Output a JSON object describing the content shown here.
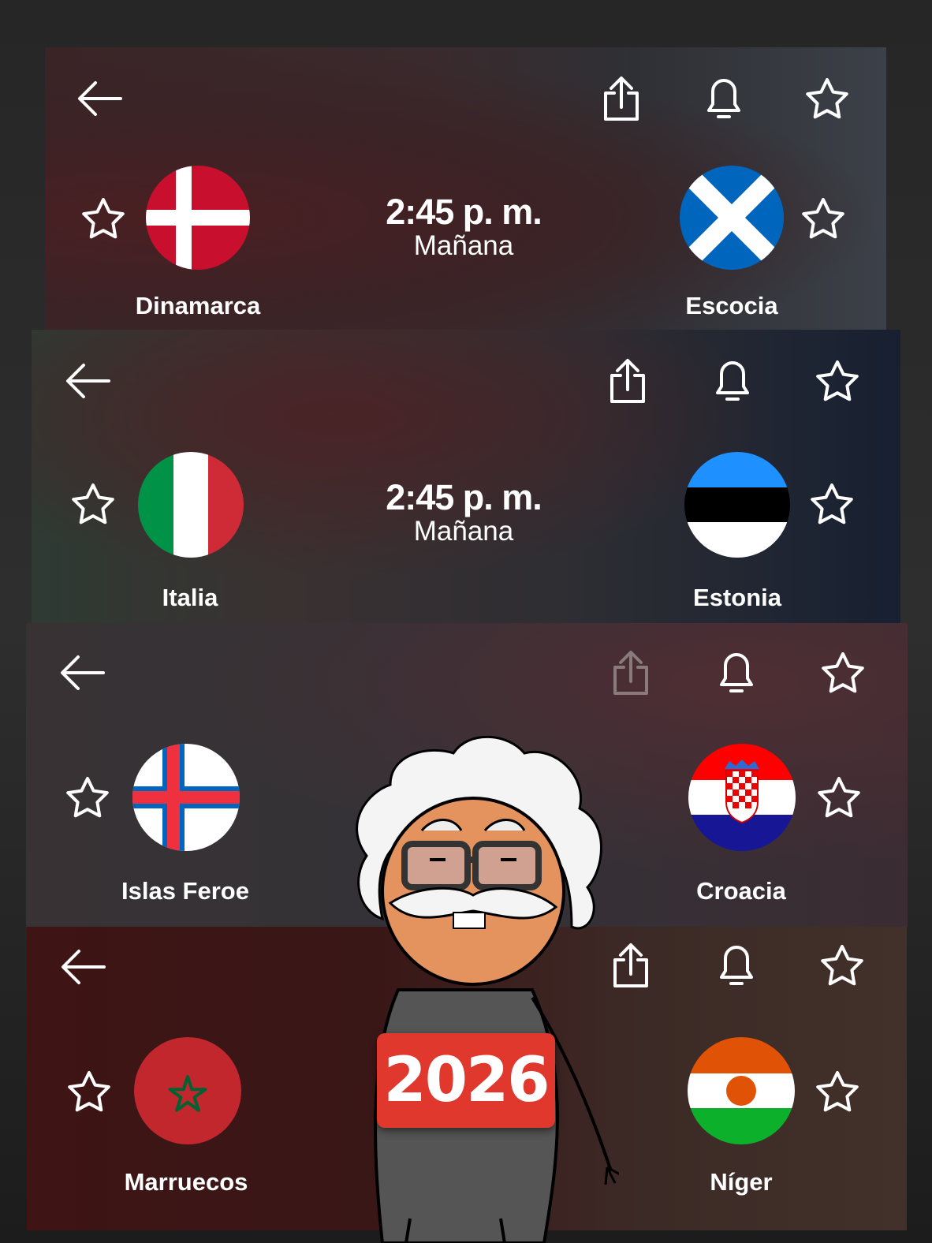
{
  "matches": [
    {
      "home": "Dinamarca",
      "away": "Escocia",
      "time": "2:45 p. m.",
      "day": "Mañana"
    },
    {
      "home": "Italia",
      "away": "Estonia",
      "time": "2:45 p. m.",
      "day": "Mañana"
    },
    {
      "home": "Islas Feroe",
      "away": "Croacia"
    },
    {
      "home": "Marruecos",
      "away": "Níger"
    }
  ],
  "badge": "2026",
  "icons": {
    "back": "arrow-left-icon",
    "share": "share-icon",
    "bell": "bell-icon",
    "star": "star-outline-icon"
  },
  "colors": {
    "icon": "#ffffff",
    "share_disabled": "#8a7a7c",
    "badge": "#e0382c"
  }
}
